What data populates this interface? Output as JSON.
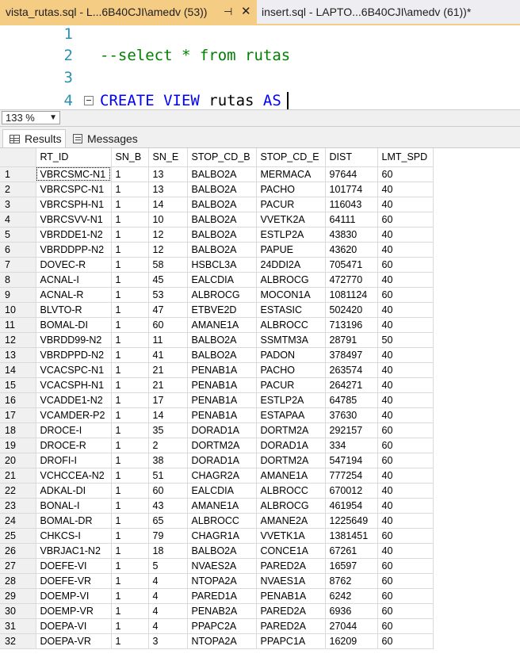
{
  "tabs": [
    {
      "label": "vista_rutas.sql - L...6B40CJI\\amedv (53))",
      "pin": "⊣",
      "close": "✕"
    },
    {
      "label": "insert.sql - LAPTO...6B40CJI\\amedv (61))*"
    }
  ],
  "editor": {
    "line_numbers": [
      "1",
      "2",
      "3",
      "4"
    ],
    "line2_comment": "--select * from rutas",
    "line4_kw1": "CREATE VIEW",
    "line4_name": " rutas ",
    "line4_kw2": "AS"
  },
  "zoom": {
    "value": "133 %"
  },
  "result_tabs": {
    "results": "Results",
    "messages": "Messages"
  },
  "grid": {
    "columns": [
      "RT_ID",
      "SN_B",
      "SN_E",
      "STOP_CD_B",
      "STOP_CD_E",
      "DIST",
      "LMT_SPD"
    ],
    "rows": [
      [
        "1",
        "VBRCSMC-N1",
        "1",
        "13",
        "BALBO2A",
        "MERMACA",
        "97644",
        "60"
      ],
      [
        "2",
        "VBRCSPC-N1",
        "1",
        "13",
        "BALBO2A",
        "PACHO",
        "101774",
        "40"
      ],
      [
        "3",
        "VBRCSPH-N1",
        "1",
        "14",
        "BALBO2A",
        "PACUR",
        "116043",
        "40"
      ],
      [
        "4",
        "VBRCSVV-N1",
        "1",
        "10",
        "BALBO2A",
        "VVETK2A",
        "64111",
        "60"
      ],
      [
        "5",
        "VBRDDE1-N2",
        "1",
        "12",
        "BALBO2A",
        "ESTLP2A",
        "43830",
        "40"
      ],
      [
        "6",
        "VBRDDPP-N2",
        "1",
        "12",
        "BALBO2A",
        "PAPUE",
        "43620",
        "40"
      ],
      [
        "7",
        "DOVEC-R",
        "1",
        "58",
        "HSBCL3A",
        "24DDI2A",
        "705471",
        "60"
      ],
      [
        "8",
        "ACNAL-I",
        "1",
        "45",
        "EALCDIA",
        "ALBROCG",
        "472770",
        "40"
      ],
      [
        "9",
        "ACNAL-R",
        "1",
        "53",
        "ALBROCG",
        "MOCON1A",
        "1081124",
        "60"
      ],
      [
        "10",
        "BLVTO-R",
        "1",
        "47",
        "ETBVE2D",
        "ESTASIC",
        "502420",
        "40"
      ],
      [
        "11",
        "BOMAL-DI",
        "1",
        "60",
        "AMANE1A",
        "ALBROCC",
        "713196",
        "40"
      ],
      [
        "12",
        "VBRDD99-N2",
        "1",
        "11",
        "BALBO2A",
        "SSMTM3A",
        "28791",
        "50"
      ],
      [
        "13",
        "VBRDPPD-N2",
        "1",
        "41",
        "BALBO2A",
        "PADON",
        "378497",
        "40"
      ],
      [
        "14",
        "VCACSPC-N1",
        "1",
        "21",
        "PENAB1A",
        "PACHO",
        "263574",
        "40"
      ],
      [
        "15",
        "VCACSPH-N1",
        "1",
        "21",
        "PENAB1A",
        "PACUR",
        "264271",
        "40"
      ],
      [
        "16",
        "VCADDE1-N2",
        "1",
        "17",
        "PENAB1A",
        "ESTLP2A",
        "64785",
        "40"
      ],
      [
        "17",
        "VCAMDER-P2",
        "1",
        "14",
        "PENAB1A",
        "ESTAPAA",
        "37630",
        "40"
      ],
      [
        "18",
        "DROCE-I",
        "1",
        "35",
        "DORAD1A",
        "DORTM2A",
        "292157",
        "60"
      ],
      [
        "19",
        "DROCE-R",
        "1",
        "2",
        "DORTM2A",
        "DORAD1A",
        "334",
        "60"
      ],
      [
        "20",
        "DROFI-I",
        "1",
        "38",
        "DORAD1A",
        "DORTM2A",
        "547194",
        "60"
      ],
      [
        "21",
        "VCHCCEA-N2",
        "1",
        "51",
        "CHAGR2A",
        "AMANE1A",
        "777254",
        "40"
      ],
      [
        "22",
        "ADKAL-DI",
        "1",
        "60",
        "EALCDIA",
        "ALBROCC",
        "670012",
        "40"
      ],
      [
        "23",
        "BONAL-I",
        "1",
        "43",
        "AMANE1A",
        "ALBROCG",
        "461954",
        "40"
      ],
      [
        "24",
        "BOMAL-DR",
        "1",
        "65",
        "ALBROCC",
        "AMANE2A",
        "1225649",
        "40"
      ],
      [
        "25",
        "CHKCS-I",
        "1",
        "79",
        "CHAGR1A",
        "VVETK1A",
        "1381451",
        "60"
      ],
      [
        "26",
        "VBRJAC1-N2",
        "1",
        "18",
        "BALBO2A",
        "CONCE1A",
        "67261",
        "40"
      ],
      [
        "27",
        "DOEFE-VI",
        "1",
        "5",
        "NVAES2A",
        "PARED2A",
        "16597",
        "60"
      ],
      [
        "28",
        "DOEFE-VR",
        "1",
        "4",
        "NTOPA2A",
        "NVAES1A",
        "8762",
        "60"
      ],
      [
        "29",
        "DOEMP-VI",
        "1",
        "4",
        "PARED1A",
        "PENAB1A",
        "6242",
        "60"
      ],
      [
        "30",
        "DOEMP-VR",
        "1",
        "4",
        "PENAB2A",
        "PARED2A",
        "6936",
        "60"
      ],
      [
        "31",
        "DOEPA-VI",
        "1",
        "4",
        "PPAPC2A",
        "PARED2A",
        "27044",
        "60"
      ],
      [
        "32",
        "DOEPA-VR",
        "1",
        "3",
        "NTOPA2A",
        "PPAPC1A",
        "16209",
        "60"
      ]
    ]
  }
}
